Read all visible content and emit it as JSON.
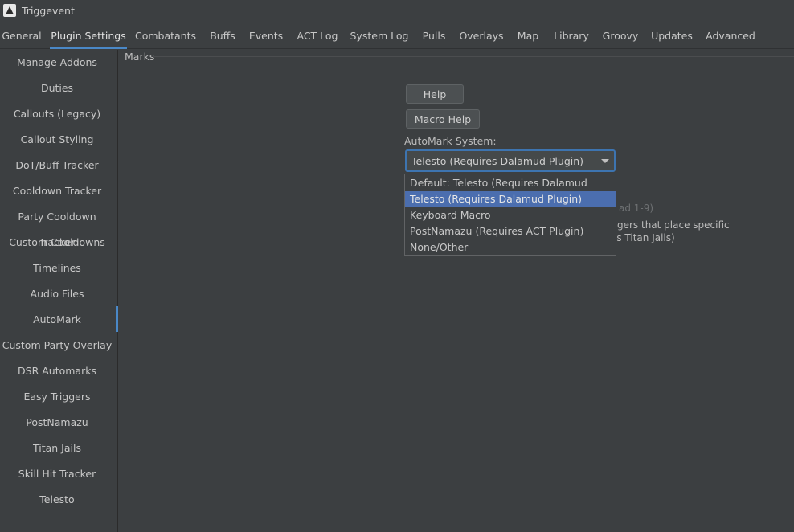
{
  "app": {
    "title": "Triggevent"
  },
  "tabs": [
    {
      "label": "General"
    },
    {
      "label": "Plugin Settings"
    },
    {
      "label": "Combatants"
    },
    {
      "label": "Buffs"
    },
    {
      "label": "Events"
    },
    {
      "label": "ACT Log"
    },
    {
      "label": "System Log"
    },
    {
      "label": "Pulls"
    },
    {
      "label": "Overlays"
    },
    {
      "label": "Map"
    },
    {
      "label": "Library"
    },
    {
      "label": "Groovy"
    },
    {
      "label": "Updates"
    },
    {
      "label": "Advanced"
    }
  ],
  "active_tab": "Plugin Settings",
  "sidebar": {
    "items": [
      {
        "label": "Manage Addons"
      },
      {
        "label": "Duties"
      },
      {
        "label": "Callouts (Legacy)"
      },
      {
        "label": "Callout Styling"
      },
      {
        "label": "DoT/Buff Tracker"
      },
      {
        "label": "Cooldown Tracker"
      },
      {
        "label": "Party Cooldown Tracker"
      },
      {
        "label": "Custom Cooldowns"
      },
      {
        "label": "Timelines"
      },
      {
        "label": "Audio Files"
      },
      {
        "label": "AutoMark"
      },
      {
        "label": "Custom Party Overlay"
      },
      {
        "label": "DSR Automarks"
      },
      {
        "label": "Easy Triggers"
      },
      {
        "label": "PostNamazu"
      },
      {
        "label": "Titan Jails"
      },
      {
        "label": "Skill Hit Tracker"
      },
      {
        "label": "Telesto"
      }
    ],
    "active": "AutoMark"
  },
  "content": {
    "group_title": "Marks",
    "help_button": "Help",
    "macro_help_button": "Macro Help",
    "automark_label": "AutoMark System:",
    "combo_value": "Telesto (Requires Dalamud Plugin)",
    "options": [
      {
        "label": "Default: Telesto (Requires Dalamud Plugin)",
        "selected": false
      },
      {
        "label": "Telesto (Requires Dalamud Plugin)",
        "selected": true
      },
      {
        "label": "Keyboard Macro",
        "selected": false
      },
      {
        "label": "PostNamazu (Requires ACT Plugin)",
        "selected": false
      },
      {
        "label": "None/Other",
        "selected": false
      }
    ],
    "obscured_text": {
      "line1": "ad 1-9)",
      "line2": "gers that place specific",
      "line3": "as Titan Jails)"
    }
  },
  "colors": {
    "background": "#3c3f41",
    "accent": "#4a88c7",
    "selection": "#4b6eaf"
  }
}
